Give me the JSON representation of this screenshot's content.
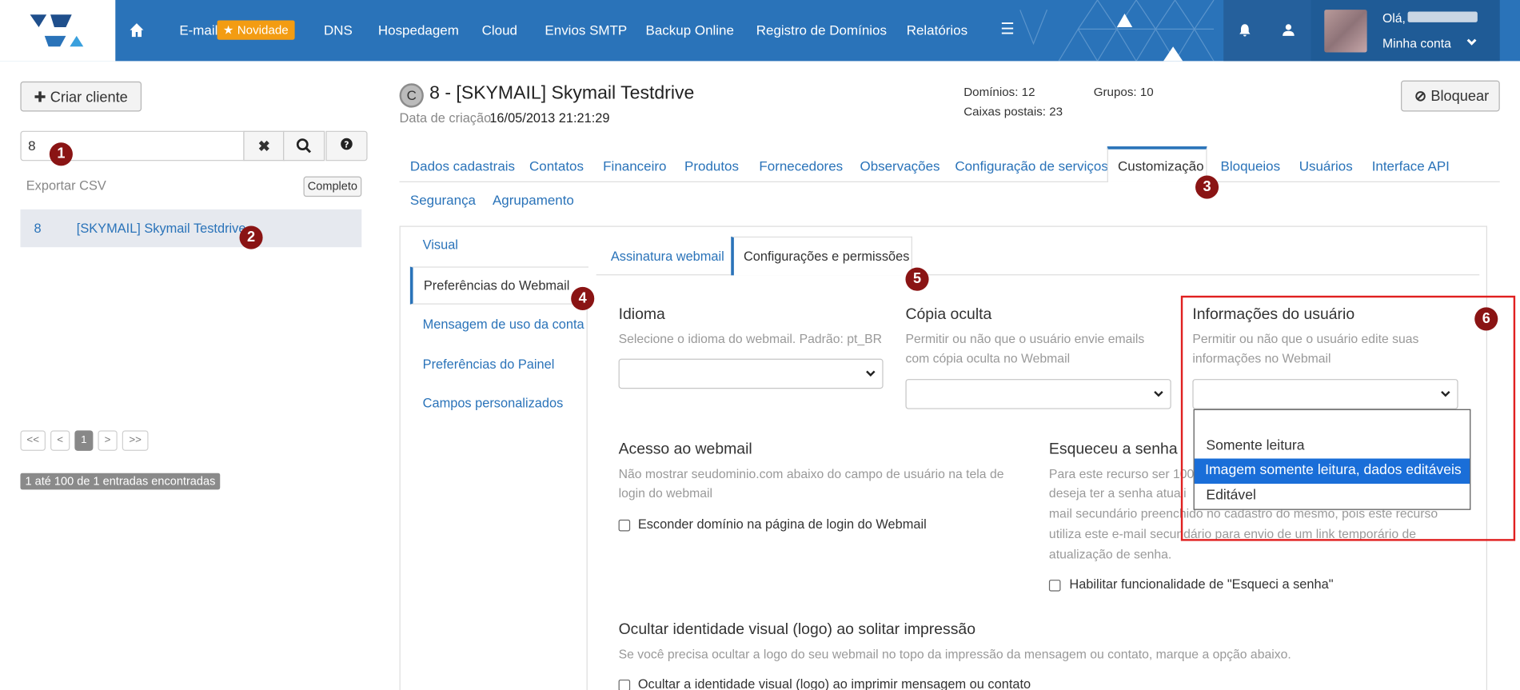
{
  "topnav": {
    "items": [
      "E-mail",
      "DNS",
      "Hospedagem",
      "Cloud",
      "Envios SMTP",
      "Backup Online",
      "Registro de Domínios",
      "Relatórios"
    ],
    "email_badge": "Novidade",
    "greeting": "Olá,",
    "account": "Minha conta"
  },
  "sidebar": {
    "create_client": "Criar cliente",
    "search_value": "8",
    "export_csv": "Exportar CSV",
    "complete_btn": "Completo",
    "result": {
      "id": "8",
      "name": "[SKYMAIL] Skymail Testdrive"
    },
    "pagination": [
      "<<",
      "<",
      "1",
      ">",
      ">>"
    ],
    "entries_text": "1 até 100 de 1 entradas encontradas"
  },
  "markers": [
    "1",
    "2",
    "3",
    "4",
    "5",
    "6"
  ],
  "client": {
    "badge": "C",
    "title": "8 - [SKYMAIL] Skymail Testdrive",
    "created_label": "Data de criação",
    "created_value": "16/05/2013 21:21:29",
    "domains": "Domínios: 12",
    "mailboxes": "Caixas postais: 23",
    "groups": "Grupos: 10",
    "block_btn": "Bloquear"
  },
  "tabs": [
    "Dados cadastrais",
    "Contatos",
    "Financeiro",
    "Produtos",
    "Fornecedores",
    "Observações",
    "Configuração de serviços",
    "Customização",
    "Bloqueios",
    "Usuários",
    "Interface API",
    "Segurança",
    "Agrupamento"
  ],
  "active_tab": "Customização",
  "sidenav": [
    "Visual",
    "Preferências do Webmail",
    "Mensagem de uso da conta",
    "Preferências do Painel",
    "Campos personalizados"
  ],
  "subtabs": [
    "Assinatura webmail",
    "Configurações e permissões"
  ],
  "sections": {
    "idioma": {
      "title": "Idioma",
      "desc": "Selecione o idioma do webmail. Padrão: pt_BR"
    },
    "bcc": {
      "title": "Cópia oculta",
      "desc1": "Permitir ou não que o usuário envie emails",
      "desc2": "com cópia oculta no Webmail"
    },
    "userinfo": {
      "title": "Informações do usuário",
      "desc1": "Permitir ou não que o usuário edite suas",
      "desc2": "informações no Webmail"
    },
    "webmail_access": {
      "title": "Acesso ao webmail",
      "desc1": "Não mostrar seudominio.com abaixo do campo de usuário na tela de",
      "desc2": "login do webmail",
      "checkbox": "Esconder domínio na página de login do Webmail"
    },
    "forgot": {
      "title": "Esqueceu a senha",
      "desc1": "Para este recurso ser 100",
      "desc2": "deseja ter a senha atuali",
      "desc3": "mail secundário preenchido no cadastro do mesmo, pois este recurso",
      "desc4": "utiliza este e-mail secundário para envio de um link temporário de",
      "desc5": "atualização de senha.",
      "checkbox": "Habilitar funcionalidade de \"Esqueci a senha\""
    },
    "hide_logo": {
      "title": "Ocultar identidade visual (logo) ao solitar impressão",
      "desc": "Se você precisa ocultar a logo do seu webmail no topo da impressão da mensagem ou contato, marque a opção abaixo.",
      "checkbox": "Ocultar a identidade visual (logo) ao imprimir mensagem ou contato"
    }
  },
  "dropdown_options": [
    "",
    "Somente leitura",
    "Imagem somente leitura, dados editáveis",
    "Editável"
  ],
  "dropdown_selected": "Imagem somente leitura, dados editáveis",
  "colors": {
    "brand": "#2a73b9",
    "marker": "#8a1414",
    "highlight": "#1a6ed8",
    "annotation": "#e02020"
  }
}
